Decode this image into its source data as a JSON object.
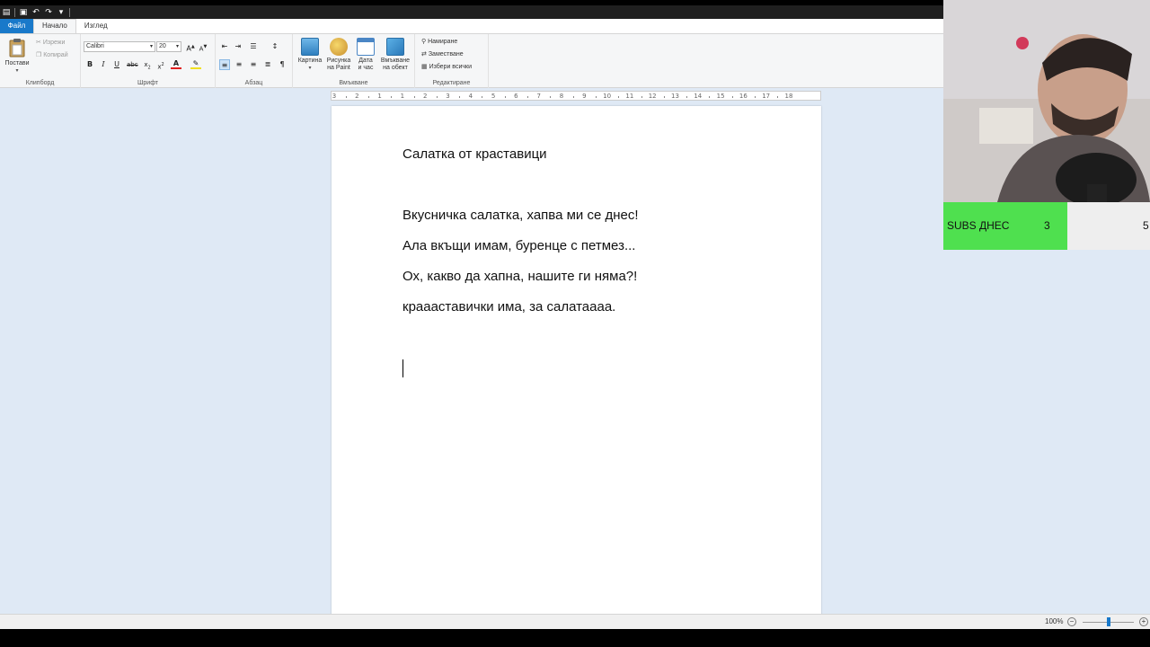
{
  "quick_access": {
    "icons": [
      "app-menu-icon",
      "save-icon",
      "undo-icon",
      "redo-icon",
      "customize-qat-icon"
    ]
  },
  "tabs": {
    "file": "Файл",
    "home": "Начало",
    "view": "Изглед"
  },
  "ribbon": {
    "clipboard": {
      "paste": "Постави",
      "cut": "Изрежи",
      "copy": "Копирай",
      "label": "Клипборд"
    },
    "font": {
      "family": "Calibri",
      "size": "20",
      "label": "Шрифт"
    },
    "paragraph": {
      "label": "Абзац"
    },
    "insert": {
      "picture": "Картина",
      "paint_line1": "Рисунка",
      "paint_line2": "на Paint",
      "datetime_line1": "Дата",
      "datetime_line2": "и час",
      "object_line1": "Вмъкване",
      "object_line2": "на обект",
      "label": "Вмъкване"
    },
    "editing": {
      "find": "Намиране",
      "replace": "Заместване",
      "select_all": "Избери всички",
      "label": "Редактиране"
    }
  },
  "ruler": {
    "labels": [
      "3",
      "2",
      "1",
      "1",
      "2",
      "3",
      "4",
      "5",
      "6",
      "7",
      "8",
      "9",
      "10",
      "11",
      "12",
      "13",
      "14",
      "15",
      "16",
      "17",
      "18"
    ]
  },
  "document": {
    "title": "Салатка от краставици",
    "lines": [
      "Вкусничка салатка, хапва ми се днес!",
      "Ала вкъщи имам, буренце с петмез...",
      "Ох, какво да хапна, нашите ги няма?!",
      "краааставички има, за салатаааа."
    ]
  },
  "status": {
    "zoom": "100%",
    "zoom_level": 0.5
  },
  "overlay": {
    "subs_label": "SUBS ДНЕС",
    "subs_count": "3",
    "subs_goal": "5"
  },
  "colors": {
    "accent": "#1979ca",
    "workspace": "#dfe9f5",
    "subs_bar": "#4fe04f"
  }
}
